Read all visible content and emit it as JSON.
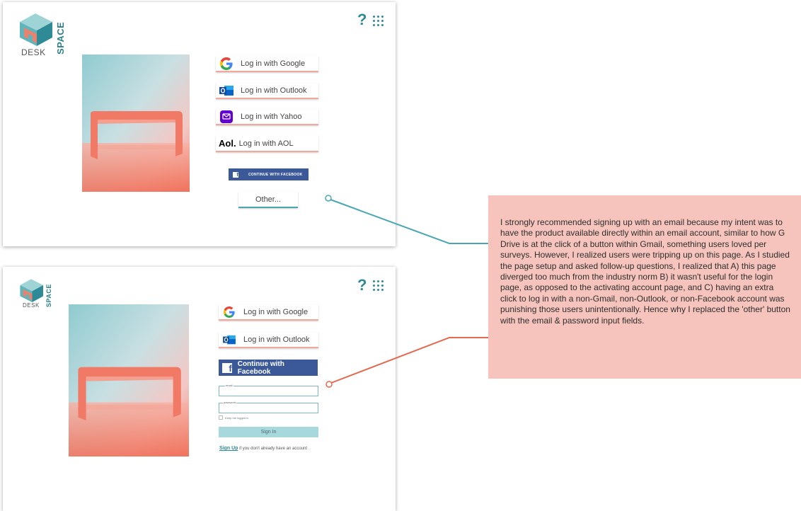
{
  "brand": {
    "desk": "DESK",
    "space": "SPACE"
  },
  "header": {
    "help": "?"
  },
  "top_screen": {
    "buttons": [
      {
        "label": "Log in with Google",
        "icon": "google-icon"
      },
      {
        "label": "Log in with Outlook",
        "icon": "outlook-icon"
      },
      {
        "label": "Log in with Yahoo",
        "icon": "yahoo-icon"
      },
      {
        "label": "Log in with AOL",
        "icon": "aol-icon",
        "icon_text": "Aol."
      }
    ],
    "facebook_label": "CONTINUE WITH FACEBOOK",
    "other_label": "Other..."
  },
  "bottom_screen": {
    "buttons": [
      {
        "label": "Log in with Google",
        "icon": "google-icon"
      },
      {
        "label": "Log in with Outlook",
        "icon": "outlook-icon"
      }
    ],
    "facebook_label": "Continue with Facebook",
    "email_label": "email",
    "password_label": "password",
    "keep_logged_in": "Keep me logged in",
    "signin_label": "Sign In",
    "signup_link": "Sign Up",
    "signup_rest": " if you don't already have an account"
  },
  "note": "I strongly recommended signing up with an email because my intent was to have the product available directly within an email account, similar to how G Drive is at the click of a button within Gmail, something users loved per surveys.  However, I realized users were tripping up on this page. As I studied the page setup and asked follow-up questions, I realized that A) this page diverged too much from the industry norm B) it wasn't useful for the login page, as opposed to the activating account page, and C) having an extra click to log in with a non-Gmail, non-Outlook, or non-Facebook account was punishing those users unintentionally. Hence why I replaced the 'other' button with the email & password input fields.",
  "colors": {
    "accent_teal": "#2d8a96",
    "accent_coral": "#f2a89a",
    "connector_teal": "#4aa8b2",
    "connector_red": "#e4674e",
    "note_bg": "#f6c4bc",
    "facebook": "#3b5998"
  }
}
